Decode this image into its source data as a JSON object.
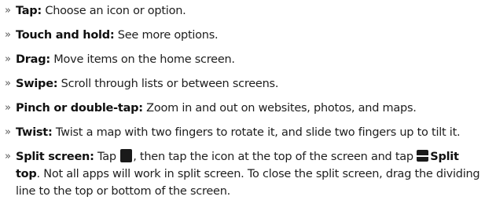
{
  "bullet_glyph": "»",
  "items": [
    {
      "term": "Tap:",
      "text": " Choose an icon or option."
    },
    {
      "term": "Touch and hold:",
      "text": " See more options."
    },
    {
      "term": "Drag:",
      "text": " Move items on the home screen."
    },
    {
      "term": "Swipe:",
      "text": " Scroll through lists or between screens."
    },
    {
      "term": "Pinch or double-tap:",
      "text": " Zoom in and out on websites, photos, and maps."
    },
    {
      "term": "Twist:",
      "text": " Twist a map with two fingers to rotate it, and slide two fingers up to tilt it."
    }
  ],
  "split_item": {
    "term": "Split screen:",
    "text_1": " Tap ",
    "icon_1": "app-square-icon",
    "text_2": ", then tap the icon at the top of the screen and tap ",
    "icon_2": "split-top-icon",
    "bold_2": "Split top",
    "text_3": ". Not all apps will work in split screen. To close the split screen, drag the dividing line to the top or bottom of the screen."
  }
}
